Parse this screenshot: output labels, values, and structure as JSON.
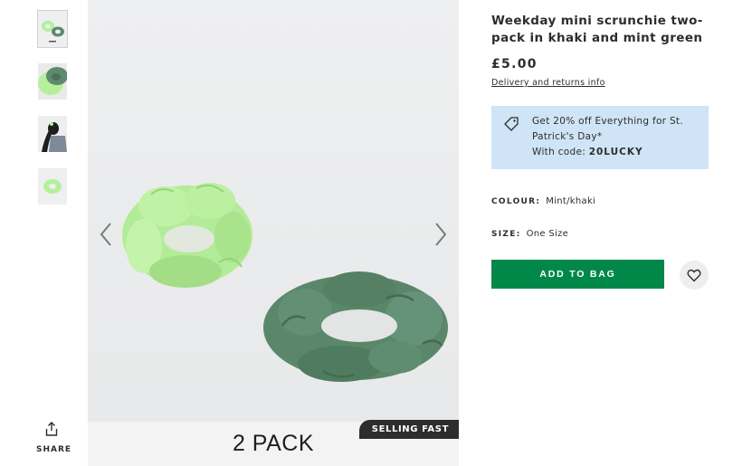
{
  "gallery": {
    "thumbnails": [
      {
        "name": "thumb-both-scrunchies",
        "active": true
      },
      {
        "name": "thumb-close-up",
        "active": false
      },
      {
        "name": "thumb-model",
        "active": false
      },
      {
        "name": "thumb-mint-scrunchie",
        "active": false
      }
    ],
    "pack_label": "2 PACK",
    "badge": "SELLING FAST",
    "share_label": "SHARE",
    "colors": {
      "mint": "#b6ef9b",
      "khaki": "#5d8a6c"
    }
  },
  "product": {
    "title": "Weekday mini scrunchie two-pack in khaki and mint green",
    "price": "£5.00",
    "delivery_link": "Delivery and returns info"
  },
  "promo": {
    "line1": "Get 20% off Everything for St. Patrick's Day*",
    "code_prefix": "With code: ",
    "code": "20LUCKY"
  },
  "options": {
    "colour_label": "COLOUR:",
    "colour_value": "Mint/khaki",
    "size_label": "SIZE:",
    "size_value": "One Size"
  },
  "actions": {
    "add_to_bag": "ADD TO BAG"
  },
  "theme": {
    "accent_green": "#018849",
    "promo_bg": "#cfe4f6",
    "badge_bg": "#2d2d2d"
  }
}
